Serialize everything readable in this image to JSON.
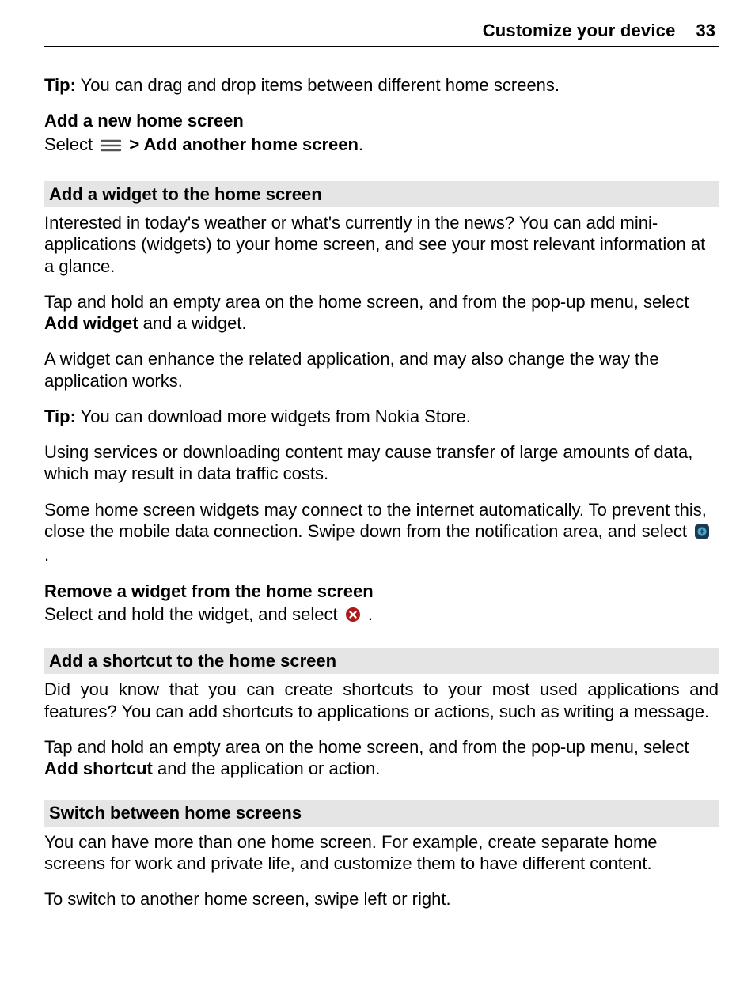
{
  "header": {
    "title": "Customize your device",
    "page_number": "33"
  },
  "tip1": {
    "label": "Tip:",
    "text": " You can drag and drop items between different home screens."
  },
  "add_home": {
    "heading": "Add a new home screen",
    "select": "Select ",
    "arrow": " > ",
    "menu_item": "Add another home screen",
    "period": "."
  },
  "add_widget": {
    "section_title": "Add a widget to the home screen",
    "intro": "Interested in today's weather or what's currently in the news? You can add mini-applications (widgets) to your home screen, and see your most relevant information at a glance.",
    "step_pre": "Tap and hold an empty area on the home screen, and from the pop-up menu, select ",
    "step_bold": "Add widget",
    "step_post": " and a widget.",
    "enhance": "A widget can enhance the related application, and may also change the way the application works.",
    "tip_label": "Tip:",
    "tip_text": " You can download more widgets from Nokia Store.",
    "data_note": "Using services or downloading content may cause transfer of large amounts of data, which may result in data traffic costs.",
    "auto_pre": "Some home screen widgets may connect to the internet automatically. To prevent this, close the mobile data connection. Swipe down from the notification area, and select ",
    "auto_post": " ."
  },
  "remove_widget": {
    "heading": "Remove a widget from the home screen",
    "text_pre": "Select and hold the widget, and select ",
    "text_post": " ."
  },
  "add_shortcut": {
    "section_title": "Add a shortcut to the home screen",
    "intro": "Did you know that you can create shortcuts to your most used applications and features? You can add shortcuts to applications or actions, such as writing a message.",
    "step_pre": "Tap and hold an empty area on the home screen, and from the pop-up menu, select ",
    "step_bold": "Add shortcut",
    "step_post": " and the application or action."
  },
  "switch_screens": {
    "section_title": "Switch between home screens",
    "intro": "You can have more than one home screen. For example, create separate home screens for work and private life, and customize them to have different content.",
    "swipe": "To switch to another home screen, swipe left or right."
  }
}
